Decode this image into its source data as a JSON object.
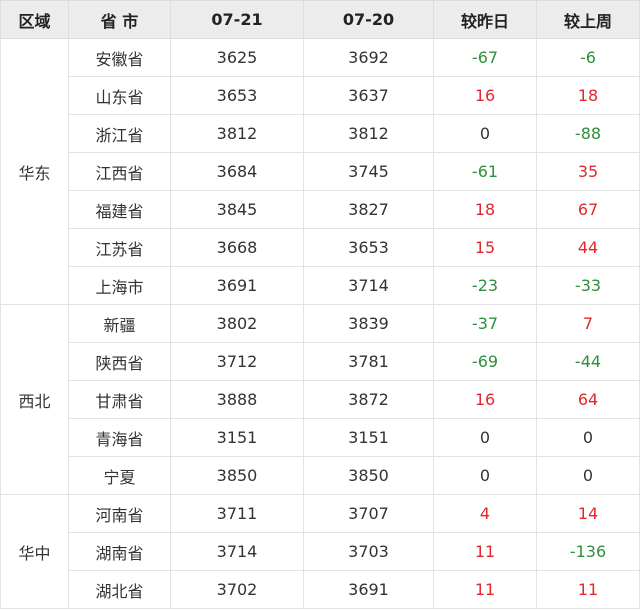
{
  "colors": {
    "up": "#e0282e",
    "down": "#2f8f3a",
    "flat": "#333333",
    "header_bg": "#ececec",
    "border": "#e2e2e2"
  },
  "table": {
    "headers": [
      "区域",
      "省 市",
      "07-21",
      "07-20",
      "较昨日",
      "较上周"
    ],
    "groups": [
      {
        "region": "华东",
        "rows": [
          {
            "province": "安徽省",
            "d0721": "3625",
            "d0720": "3692",
            "vs_yesterday": "-67",
            "vs_last_week": "-6"
          },
          {
            "province": "山东省",
            "d0721": "3653",
            "d0720": "3637",
            "vs_yesterday": "16",
            "vs_last_week": "18"
          },
          {
            "province": "浙江省",
            "d0721": "3812",
            "d0720": "3812",
            "vs_yesterday": "0",
            "vs_last_week": "-88"
          },
          {
            "province": "江西省",
            "d0721": "3684",
            "d0720": "3745",
            "vs_yesterday": "-61",
            "vs_last_week": "35"
          },
          {
            "province": "福建省",
            "d0721": "3845",
            "d0720": "3827",
            "vs_yesterday": "18",
            "vs_last_week": "67"
          },
          {
            "province": "江苏省",
            "d0721": "3668",
            "d0720": "3653",
            "vs_yesterday": "15",
            "vs_last_week": "44"
          },
          {
            "province": "上海市",
            "d0721": "3691",
            "d0720": "3714",
            "vs_yesterday": "-23",
            "vs_last_week": "-33"
          }
        ]
      },
      {
        "region": "西北",
        "rows": [
          {
            "province": "新疆",
            "d0721": "3802",
            "d0720": "3839",
            "vs_yesterday": "-37",
            "vs_last_week": "7"
          },
          {
            "province": "陕西省",
            "d0721": "3712",
            "d0720": "3781",
            "vs_yesterday": "-69",
            "vs_last_week": "-44"
          },
          {
            "province": "甘肃省",
            "d0721": "3888",
            "d0720": "3872",
            "vs_yesterday": "16",
            "vs_last_week": "64"
          },
          {
            "province": "青海省",
            "d0721": "3151",
            "d0720": "3151",
            "vs_yesterday": "0",
            "vs_last_week": "0"
          },
          {
            "province": "宁夏",
            "d0721": "3850",
            "d0720": "3850",
            "vs_yesterday": "0",
            "vs_last_week": "0"
          }
        ]
      },
      {
        "region": "华中",
        "rows": [
          {
            "province": "河南省",
            "d0721": "3711",
            "d0720": "3707",
            "vs_yesterday": "4",
            "vs_last_week": "14"
          },
          {
            "province": "湖南省",
            "d0721": "3714",
            "d0720": "3703",
            "vs_yesterday": "11",
            "vs_last_week": "-136"
          },
          {
            "province": "湖北省",
            "d0721": "3702",
            "d0720": "3691",
            "vs_yesterday": "11",
            "vs_last_week": "11"
          }
        ]
      }
    ]
  }
}
